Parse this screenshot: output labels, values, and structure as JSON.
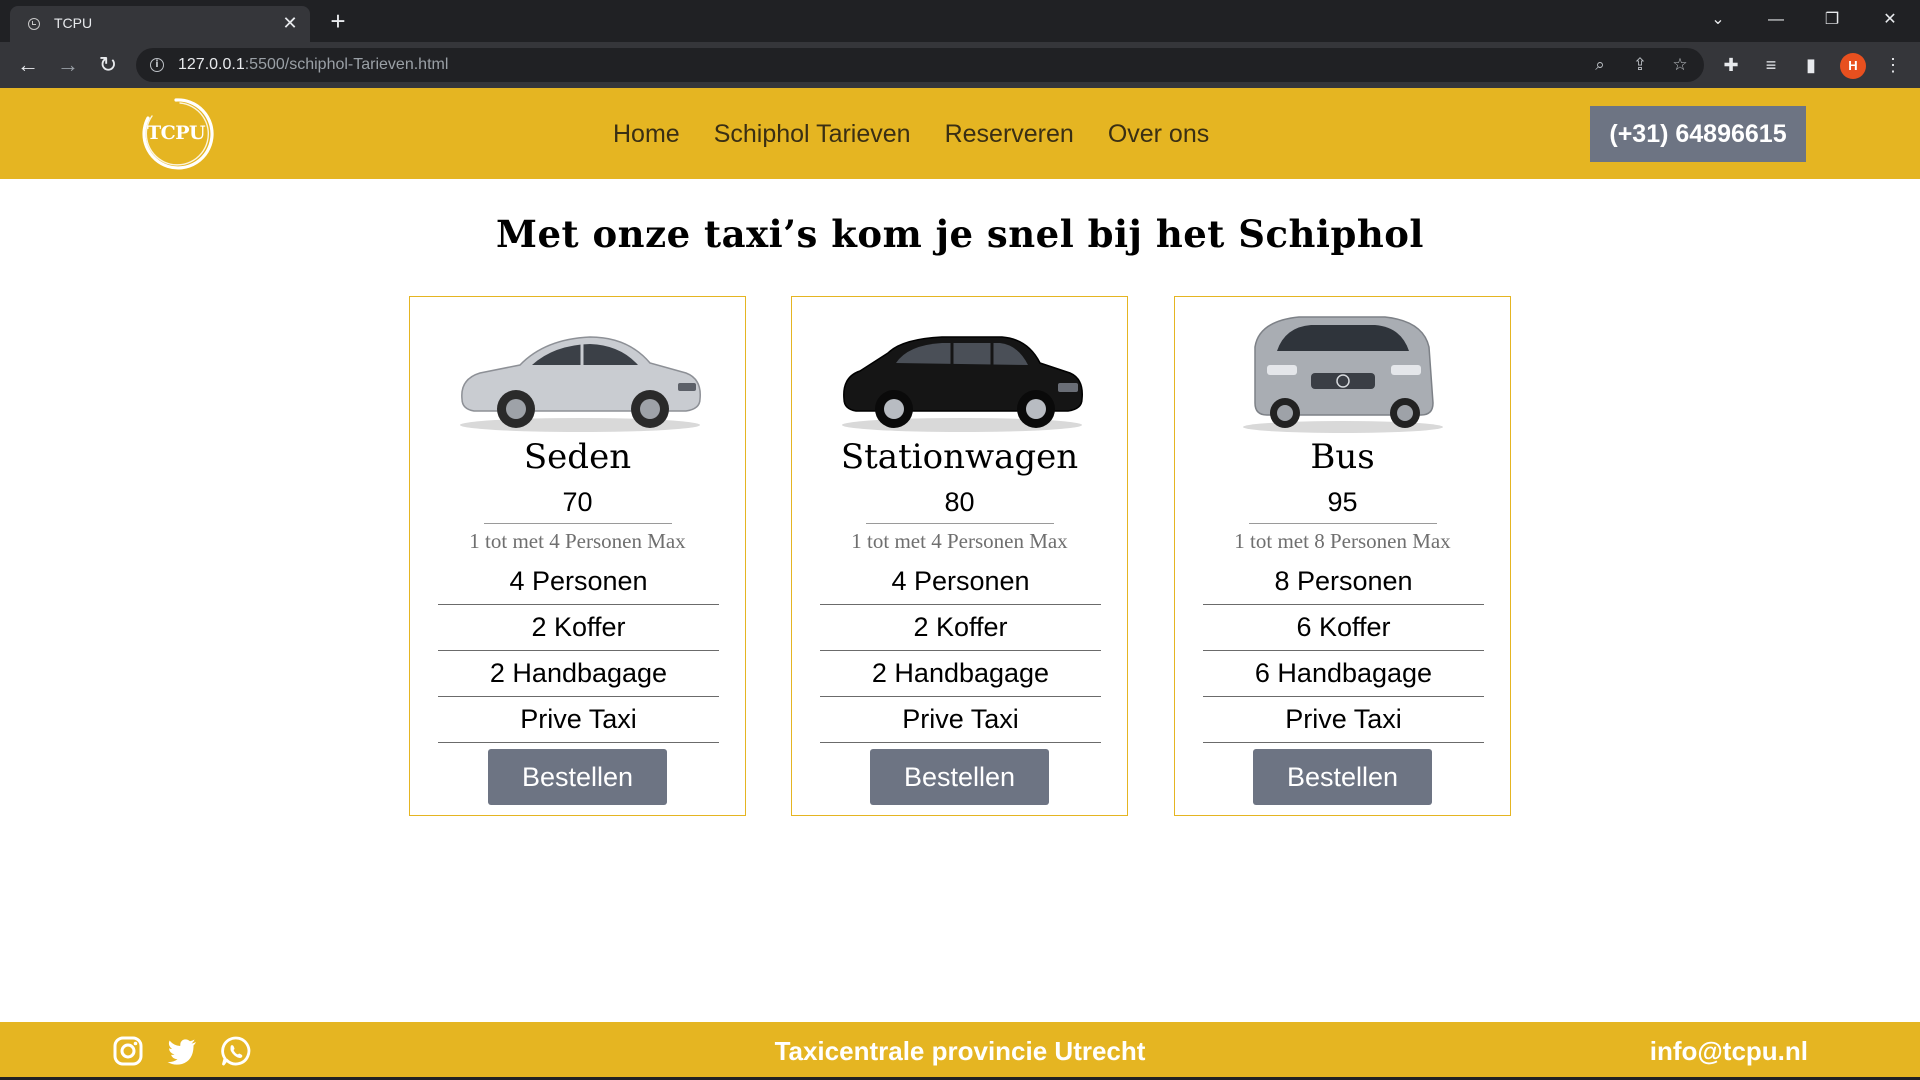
{
  "browser": {
    "tab_title": "TCPU",
    "tab_close": "✕",
    "new_tab": "+",
    "url_host": "127.0.0.1",
    "url_rest": ":5500/schiphol-Tarieven.html",
    "profile_initial": "H"
  },
  "header": {
    "logo_text": "TCPU",
    "nav": [
      "Home",
      "Schiphol Tarieven",
      "Reserveren",
      "Over ons"
    ],
    "phone": "(+31) 64896615"
  },
  "main": {
    "title": "Met onze taxi’s kom je snel bij het Schiphol",
    "cards": [
      {
        "name": "Seden",
        "price": "70",
        "capacity": "1 tot met 4 Personen Max",
        "features": [
          "4 Personen",
          "2 Koffer",
          "2 Handbagage",
          "Prive Taxi"
        ],
        "button": "Bestellen",
        "car_color": "#c9ccd1"
      },
      {
        "name": "Stationwagen",
        "price": "80",
        "capacity": "1 tot met 4 Personen Max",
        "features": [
          "4 Personen",
          "2 Koffer",
          "2 Handbagage",
          "Prive Taxi"
        ],
        "button": "Bestellen",
        "car_color": "#151515"
      },
      {
        "name": "Bus",
        "price": "95",
        "capacity": "1 tot met 8 Personen Max",
        "features": [
          "8 Personen",
          "6 Koffer",
          "6 Handbagage",
          "Prive Taxi"
        ],
        "button": "Bestellen",
        "car_color": "#a9adb3"
      }
    ]
  },
  "footer": {
    "social_icons": [
      "instagram-icon",
      "twitter-icon",
      "whatsapp-icon"
    ],
    "company": "Taxicentrale provincie Utrecht",
    "email": "info@tcpu.nl"
  },
  "colors": {
    "brand_yellow": "#e5b522",
    "button_gray": "#6d7483"
  }
}
